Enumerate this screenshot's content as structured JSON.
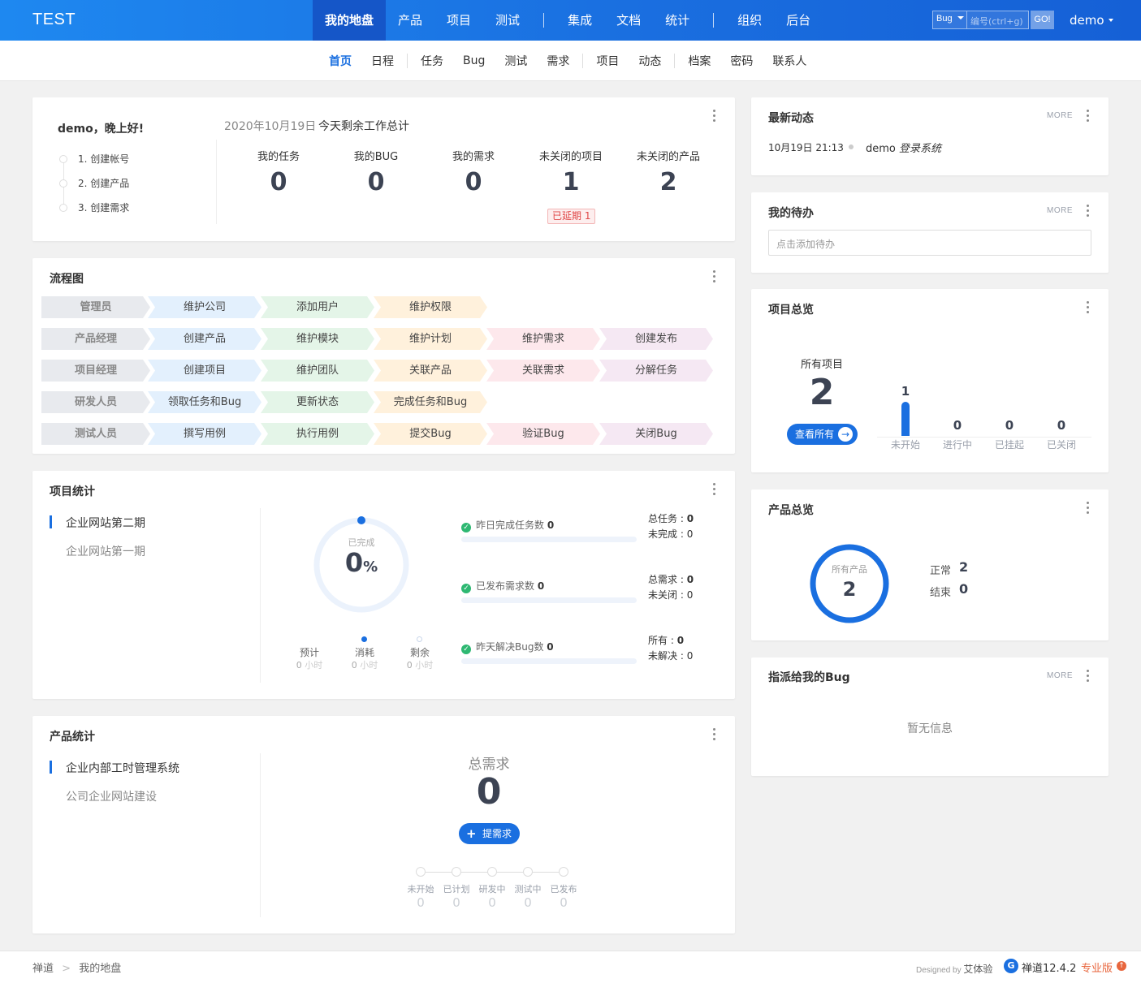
{
  "app": {
    "brand": "TEST"
  },
  "mainnav": {
    "items": [
      "我的地盘",
      "产品",
      "项目",
      "测试",
      "集成",
      "文档",
      "统计",
      "组织",
      "后台"
    ],
    "active": "我的地盘"
  },
  "search": {
    "type": "Bug",
    "placeholder": "编号(ctrl+g)",
    "go": "GO!"
  },
  "user": {
    "name": "demo"
  },
  "subnav": {
    "items": [
      "首页",
      "日程",
      "任务",
      "Bug",
      "测试",
      "需求",
      "项目",
      "动态",
      "档案",
      "密码",
      "联系人"
    ],
    "active": "首页"
  },
  "welcome": {
    "greeting": "demo，晚上好!",
    "date": "2020年10月19日",
    "summary_title": "今天剩余工作总计",
    "steps": [
      "1. 创建帐号",
      "2. 创建产品",
      "3. 创建需求"
    ],
    "stats": [
      {
        "label": "我的任务",
        "value": "0"
      },
      {
        "label": "我的BUG",
        "value": "0"
      },
      {
        "label": "我的需求",
        "value": "0"
      },
      {
        "label": "未关闭的项目",
        "value": "1"
      },
      {
        "label": "未关闭的产品",
        "value": "2"
      }
    ],
    "delayed_badge": "已延期 1"
  },
  "flow": {
    "title": "流程图",
    "rows": [
      {
        "role": "管理员",
        "steps": [
          "维护公司",
          "添加用户",
          "维护权限"
        ]
      },
      {
        "role": "产品经理",
        "steps": [
          "创建产品",
          "维护模块",
          "维护计划",
          "维护需求",
          "创建发布"
        ]
      },
      {
        "role": "项目经理",
        "steps": [
          "创建项目",
          "维护团队",
          "关联产品",
          "关联需求",
          "分解任务"
        ]
      },
      {
        "role": "研发人员",
        "steps": [
          "领取任务和Bug",
          "更新状态",
          "完成任务和Bug"
        ]
      },
      {
        "role": "测试人员",
        "steps": [
          "撰写用例",
          "执行用例",
          "提交Bug",
          "验证Bug",
          "关闭Bug"
        ]
      }
    ],
    "colors": [
      "#e8eaee",
      "#e3f0fd",
      "#e4f5e8",
      "#fff1dc",
      "#fde8ec",
      "#f5e8f3"
    ]
  },
  "project_stats": {
    "title": "项目统计",
    "projects": [
      "企业网站第二期",
      "企业网站第一期"
    ],
    "ring": {
      "label": "已完成",
      "value": "0",
      "unit": "%",
      "percent": 0
    },
    "hours": [
      {
        "label": "预计",
        "value": "0",
        "unit": "小时"
      },
      {
        "label": "消耗",
        "value": "0",
        "unit": "小时"
      },
      {
        "label": "剩余",
        "value": "0",
        "unit": "小时"
      }
    ],
    "metrics": [
      {
        "label": "昨日完成任务数",
        "value": "0",
        "k1": "总任务",
        "v1": "0",
        "k2": "未完成",
        "v2": "0"
      },
      {
        "label": "已发布需求数",
        "value": "0",
        "k1": "总需求",
        "v1": "0",
        "k2": "未关闭",
        "v2": "0"
      },
      {
        "label": "昨天解决Bug数",
        "value": "0",
        "k1": "所有",
        "v1": "0",
        "k2": "未解决",
        "v2": "0"
      }
    ]
  },
  "product_stats": {
    "title": "产品统计",
    "products": [
      "企业内部工时管理系统",
      "公司企业网站建设"
    ],
    "total_label": "总需求",
    "total_value": "0",
    "add_button": "提需求",
    "pipeline": [
      {
        "label": "未开始",
        "value": "0"
      },
      {
        "label": "已计划",
        "value": "0"
      },
      {
        "label": "研发中",
        "value": "0"
      },
      {
        "label": "测试中",
        "value": "0"
      },
      {
        "label": "已发布",
        "value": "0"
      }
    ]
  },
  "dynamics": {
    "title": "最新动态",
    "more": "MORE",
    "items": [
      {
        "time": "10月19日 21:13",
        "user": "demo",
        "action": "登录系统"
      }
    ]
  },
  "todo": {
    "title": "我的待办",
    "more": "MORE",
    "placeholder": "点击添加待办"
  },
  "project_overview": {
    "title": "项目总览",
    "all_label": "所有项目",
    "all_value": "2",
    "view_all": "查看所有",
    "chart_data": {
      "type": "bar",
      "categories": [
        "未开始",
        "进行中",
        "已挂起",
        "已关闭"
      ],
      "values": [
        1,
        0,
        0,
        0
      ]
    }
  },
  "product_overview": {
    "title": "产品总览",
    "ring_label": "所有产品",
    "ring_value": "2",
    "rows": [
      {
        "label": "正常",
        "value": "2"
      },
      {
        "label": "结束",
        "value": "0"
      }
    ]
  },
  "assigned_bugs": {
    "title": "指派给我的Bug",
    "more": "MORE",
    "empty": "暂无信息"
  },
  "footer": {
    "breadcrumb": [
      "禅道",
      "我的地盘"
    ],
    "designed_by": "Designed by",
    "designer": "艾体验",
    "version": "禅道12.4.2",
    "edition": "专业版"
  },
  "accent": "#1a6fe0"
}
